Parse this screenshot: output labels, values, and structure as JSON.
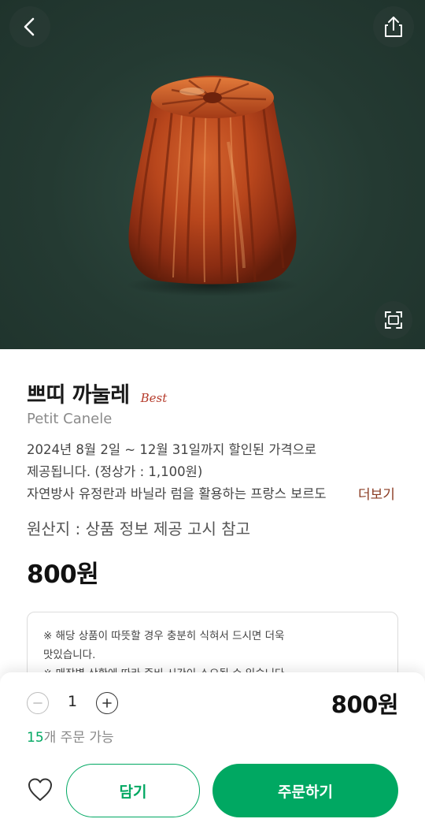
{
  "header": {
    "back_icon": "chevron-left-icon",
    "share_icon": "share-icon",
    "zoom_icon": "expand-icon"
  },
  "product": {
    "name": "쁘띠 까눌레",
    "badge": "Best",
    "english_name": "Petit Canele",
    "description_lines": [
      "2024년 8월 2일 ~ 12월 31일까지 할인된 가격으로",
      "제공됩니다. (정상가 : 1,100원)",
      "자연방사 유정란과 바닐라 럼을 활용하는 프랑스 보르도"
    ],
    "more_label": "더보기",
    "origin": "원산지 : 상품 정보 제공 고시 참고",
    "price": "800원"
  },
  "notice": {
    "lines": [
      "※ 해당 상품이 따뜻할 경우 충분히 식혀서 드시면 더욱",
      "맛있습니다.",
      "※ 매장별 상황에 따라 준비 시간이 소요될 수 있습니다."
    ]
  },
  "order_bar": {
    "quantity": "1",
    "total_price": "800원",
    "available_count": "15",
    "available_suffix": "개 주문 가능",
    "cart_label": "담기",
    "order_label": "주문하기"
  },
  "colors": {
    "brand_green": "#00a862",
    "hero_bg": "#243a32",
    "best_red": "#b53a2a",
    "more_brown": "#8a3b22"
  }
}
